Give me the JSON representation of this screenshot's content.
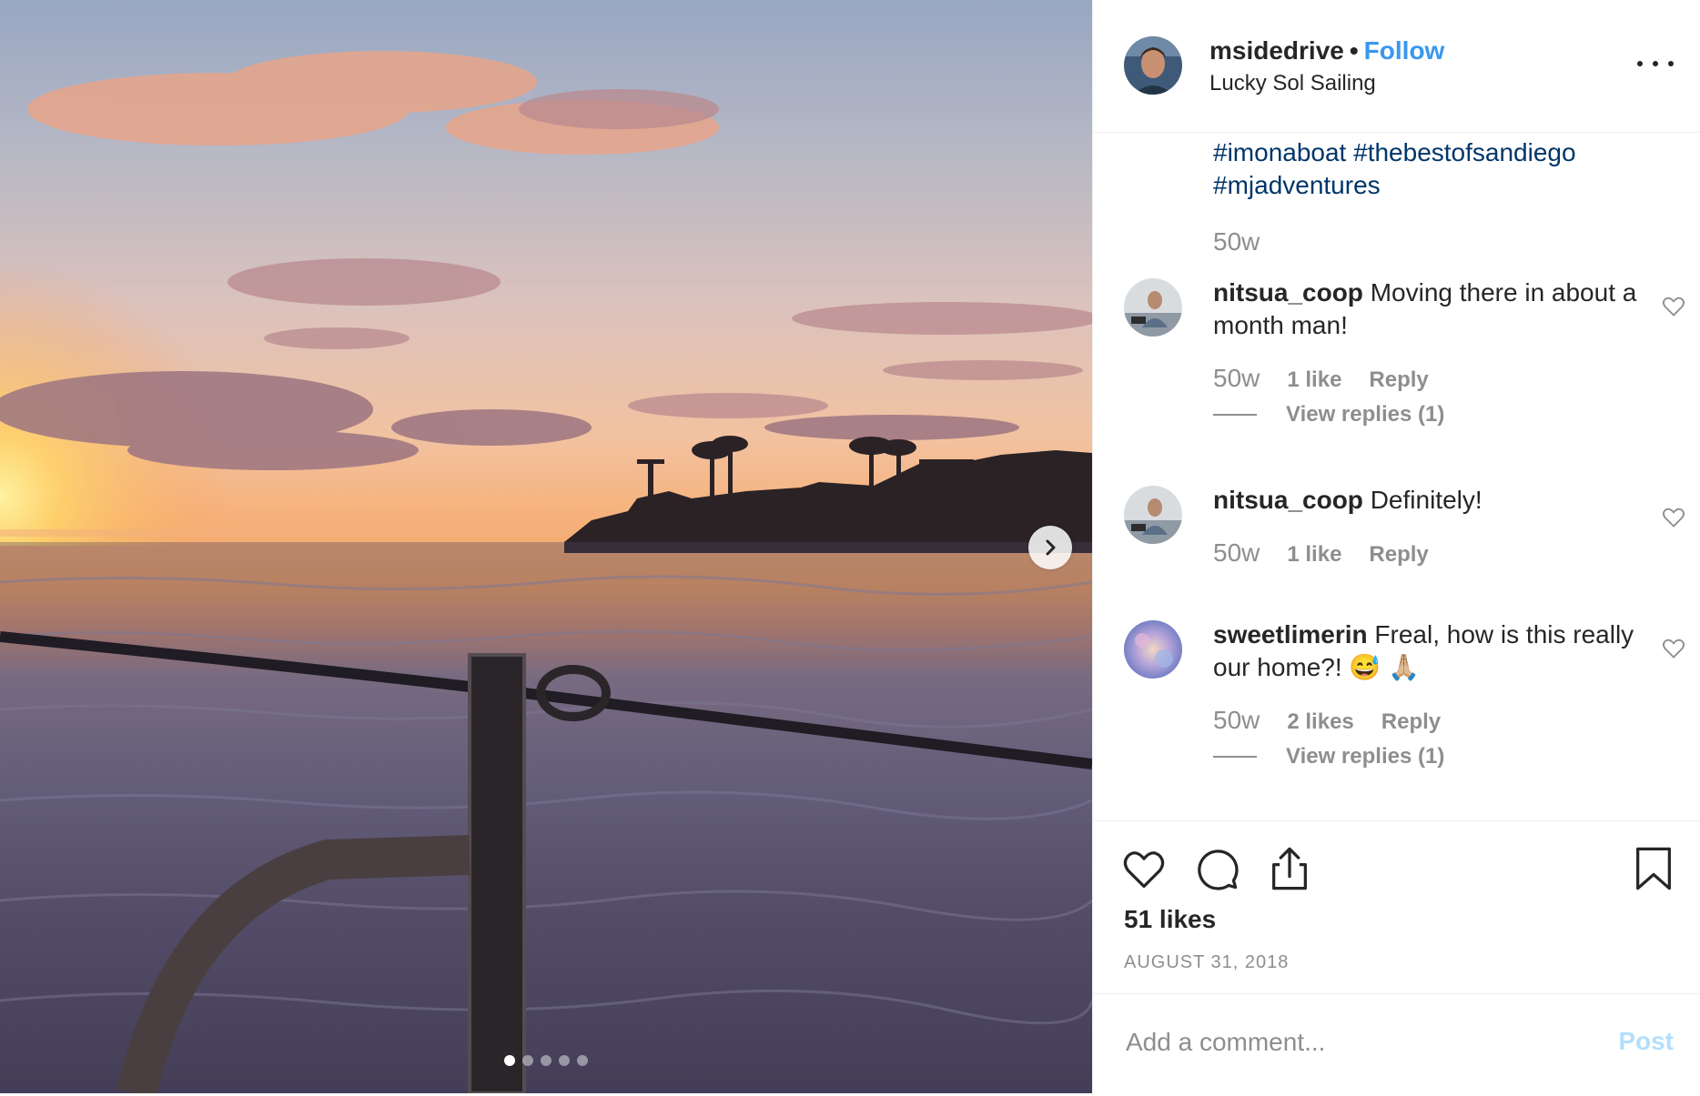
{
  "media": {
    "next_icon": "chevron-right-icon",
    "carousel_count": 5,
    "carousel_active_index": 0
  },
  "header": {
    "username": "msidedrive",
    "separator": "•",
    "follow_label": "Follow",
    "location": "Lucky Sol Sailing",
    "more_icon": "more-options-icon"
  },
  "caption": {
    "hashtags": [
      "#imonaboat",
      "#thebestofsandiego",
      "#mjadventures"
    ],
    "time": "50w"
  },
  "comments": [
    {
      "username": "nitsua_coop",
      "text": "Moving there in about a month man!",
      "time": "50w",
      "likes": "1 like",
      "reply_label": "Reply",
      "view_replies": "View replies (1)"
    },
    {
      "username": "nitsua_coop",
      "text": "Definitely!",
      "time": "50w",
      "likes": "1 like",
      "reply_label": "Reply"
    },
    {
      "username": "sweetlimerin",
      "text": "Freal, how is this really our home?! 😅 🙏🏼",
      "time": "50w",
      "likes": "2 likes",
      "reply_label": "Reply",
      "view_replies": "View replies (1)"
    }
  ],
  "actions": {
    "icons": [
      "heart-icon",
      "comment-icon",
      "share-icon",
      "bookmark-icon"
    ],
    "likes_count": "51 likes",
    "date": "AUGUST 31, 2018"
  },
  "add_comment": {
    "placeholder": "Add a comment...",
    "post_label": "Post"
  },
  "colors": {
    "link_blue": "#3897f0",
    "hashtag": "#003569",
    "muted": "#8e8e8e",
    "post_disabled": "#b2dffc"
  }
}
